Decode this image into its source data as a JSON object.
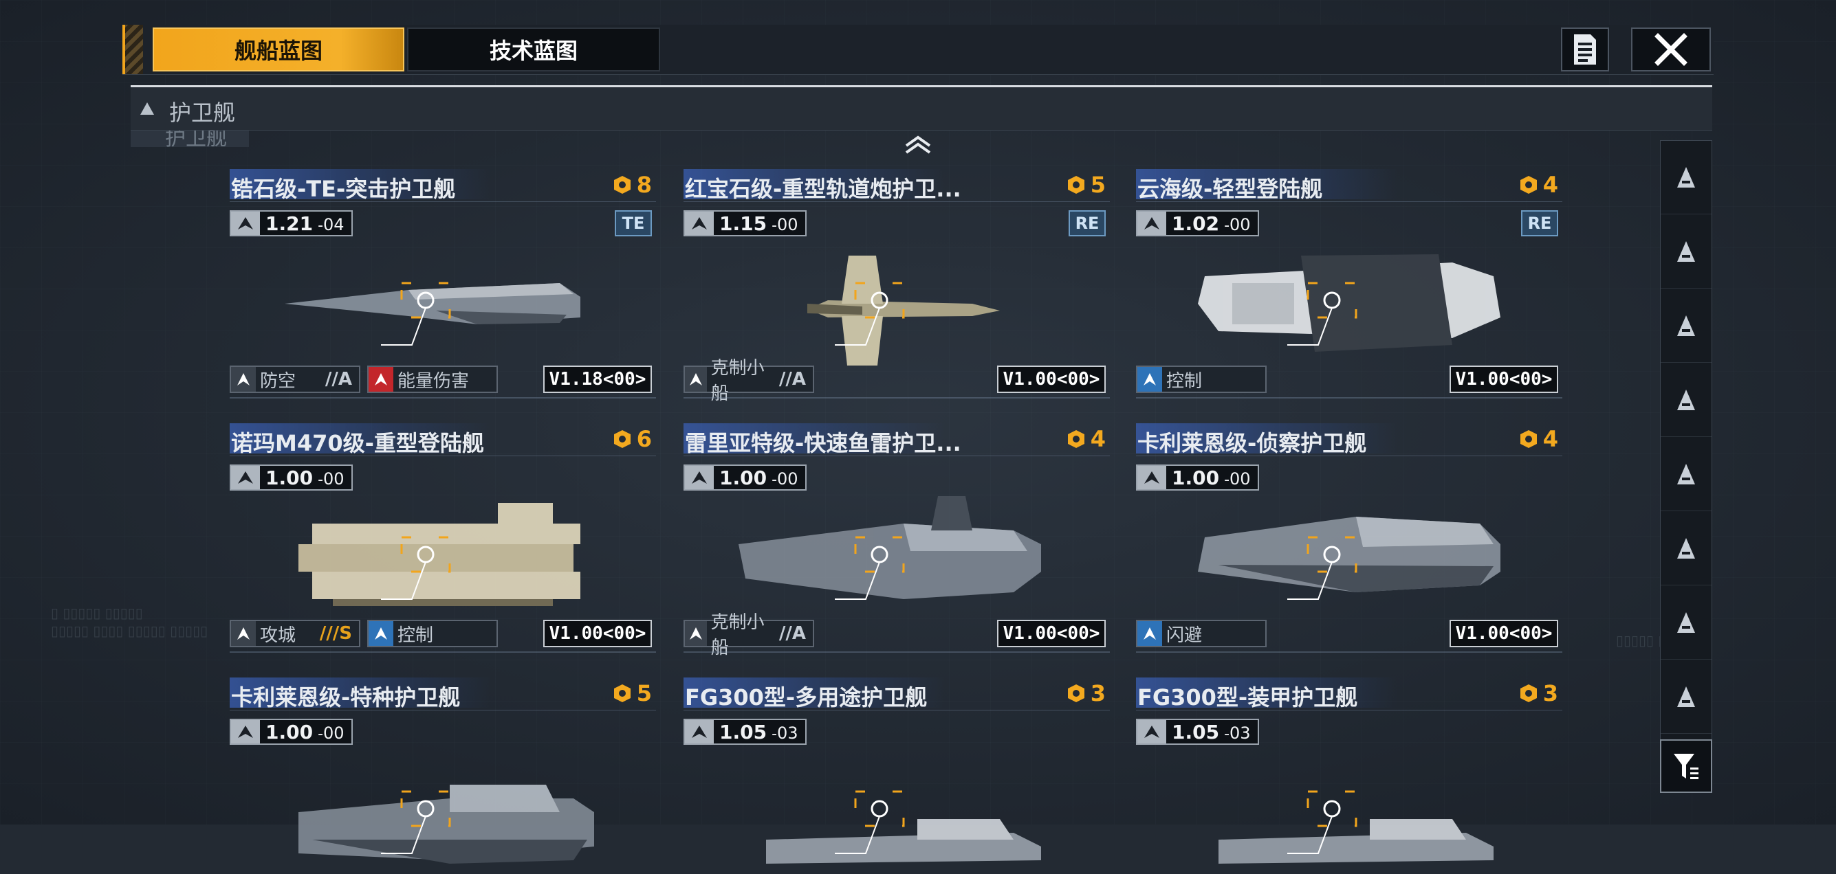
{
  "tabs": {
    "ship_blueprint": "舰船蓝图",
    "tech_blueprint": "技术蓝图"
  },
  "category": {
    "label": "护卫舰",
    "ghost_label": "护卫舰"
  },
  "cards": [
    {
      "title": "锆石级-TE-突击护卫舰",
      "rarity": "8",
      "version_icon": "fighter-icon",
      "version": "1.21",
      "version_sub": "04",
      "code": "TE",
      "tags": [
        {
          "icon": "anti-air-icon",
          "name": "防空",
          "grade": "//A",
          "style": "grey"
        },
        {
          "icon": "energy-damage-icon",
          "name": "能量伤害",
          "grade": "",
          "style": "red"
        }
      ],
      "vcode": "V1.18<00>"
    },
    {
      "title": "红宝石级-重型轨道炮护卫...",
      "rarity": "5",
      "version_icon": "railgun-icon",
      "version": "1.15",
      "version_sub": "00",
      "code": "RE",
      "tags": [
        {
          "icon": "counter-small-ship-icon",
          "name": "克制小船",
          "grade": "//A",
          "style": "grey"
        }
      ],
      "vcode": "V1.00<00>"
    },
    {
      "title": "云海级-轻型登陆舰",
      "rarity": "4",
      "version_icon": "landing-icon",
      "version": "1.02",
      "version_sub": "00",
      "code": "RE",
      "tags": [
        {
          "icon": "control-icon",
          "name": "控制",
          "grade": "",
          "style": "blue"
        }
      ],
      "vcode": "V1.00<00>"
    },
    {
      "title": "诺玛M470级-重型登陆舰",
      "rarity": "6",
      "version_icon": "railgun-icon",
      "version": "1.00",
      "version_sub": "00",
      "code": "",
      "tags": [
        {
          "icon": "siege-icon",
          "name": "攻城",
          "grade": "///S",
          "style": "grey",
          "gold": true
        },
        {
          "icon": "control-icon",
          "name": "控制",
          "grade": "",
          "style": "blue"
        }
      ],
      "vcode": "V1.00<00>"
    },
    {
      "title": "雷里亚特级-快速鱼雷护卫...",
      "rarity": "4",
      "version_icon": "torpedo-icon",
      "version": "1.00",
      "version_sub": "00",
      "code": "",
      "tags": [
        {
          "icon": "counter-small-ship-icon",
          "name": "克制小船",
          "grade": "//A",
          "style": "grey"
        }
      ],
      "vcode": "V1.00<00>"
    },
    {
      "title": "卡利莱恩级-侦察护卫舰",
      "rarity": "4",
      "version_icon": "torpedo-icon",
      "version": "1.00",
      "version_sub": "00",
      "code": "",
      "tags": [
        {
          "icon": "evasion-icon",
          "name": "闪避",
          "grade": "",
          "style": "blue"
        }
      ],
      "vcode": "V1.00<00>"
    },
    {
      "title": "卡利莱恩级-特种护卫舰",
      "rarity": "5",
      "version_icon": "torpedo-icon",
      "version": "1.00",
      "version_sub": "00",
      "code": "",
      "tags": [],
      "vcode": ""
    },
    {
      "title": "FG300型-多用途护卫舰",
      "rarity": "3",
      "version_icon": "globe-icon",
      "version": "1.05",
      "version_sub": "03",
      "code": "",
      "tags": [],
      "vcode": ""
    },
    {
      "title": "FG300型-装甲护卫舰",
      "rarity": "3",
      "version_icon": "globe-icon",
      "version": "1.05",
      "version_sub": "03",
      "code": "",
      "tags": [],
      "vcode": ""
    }
  ],
  "right_nav": [
    "carrier-icon",
    "cruiser-icon",
    "destroyer-icon",
    "frigate-icon",
    "corvette-icon",
    "landing-icon",
    "squadron-icon",
    "auxiliary-icon"
  ],
  "colors": {
    "accent": "#f2a51c",
    "rarity": "#f3a91f",
    "title_band": "#3a5fb4",
    "code_blue": "#2a4763",
    "bg": "#232a33"
  }
}
